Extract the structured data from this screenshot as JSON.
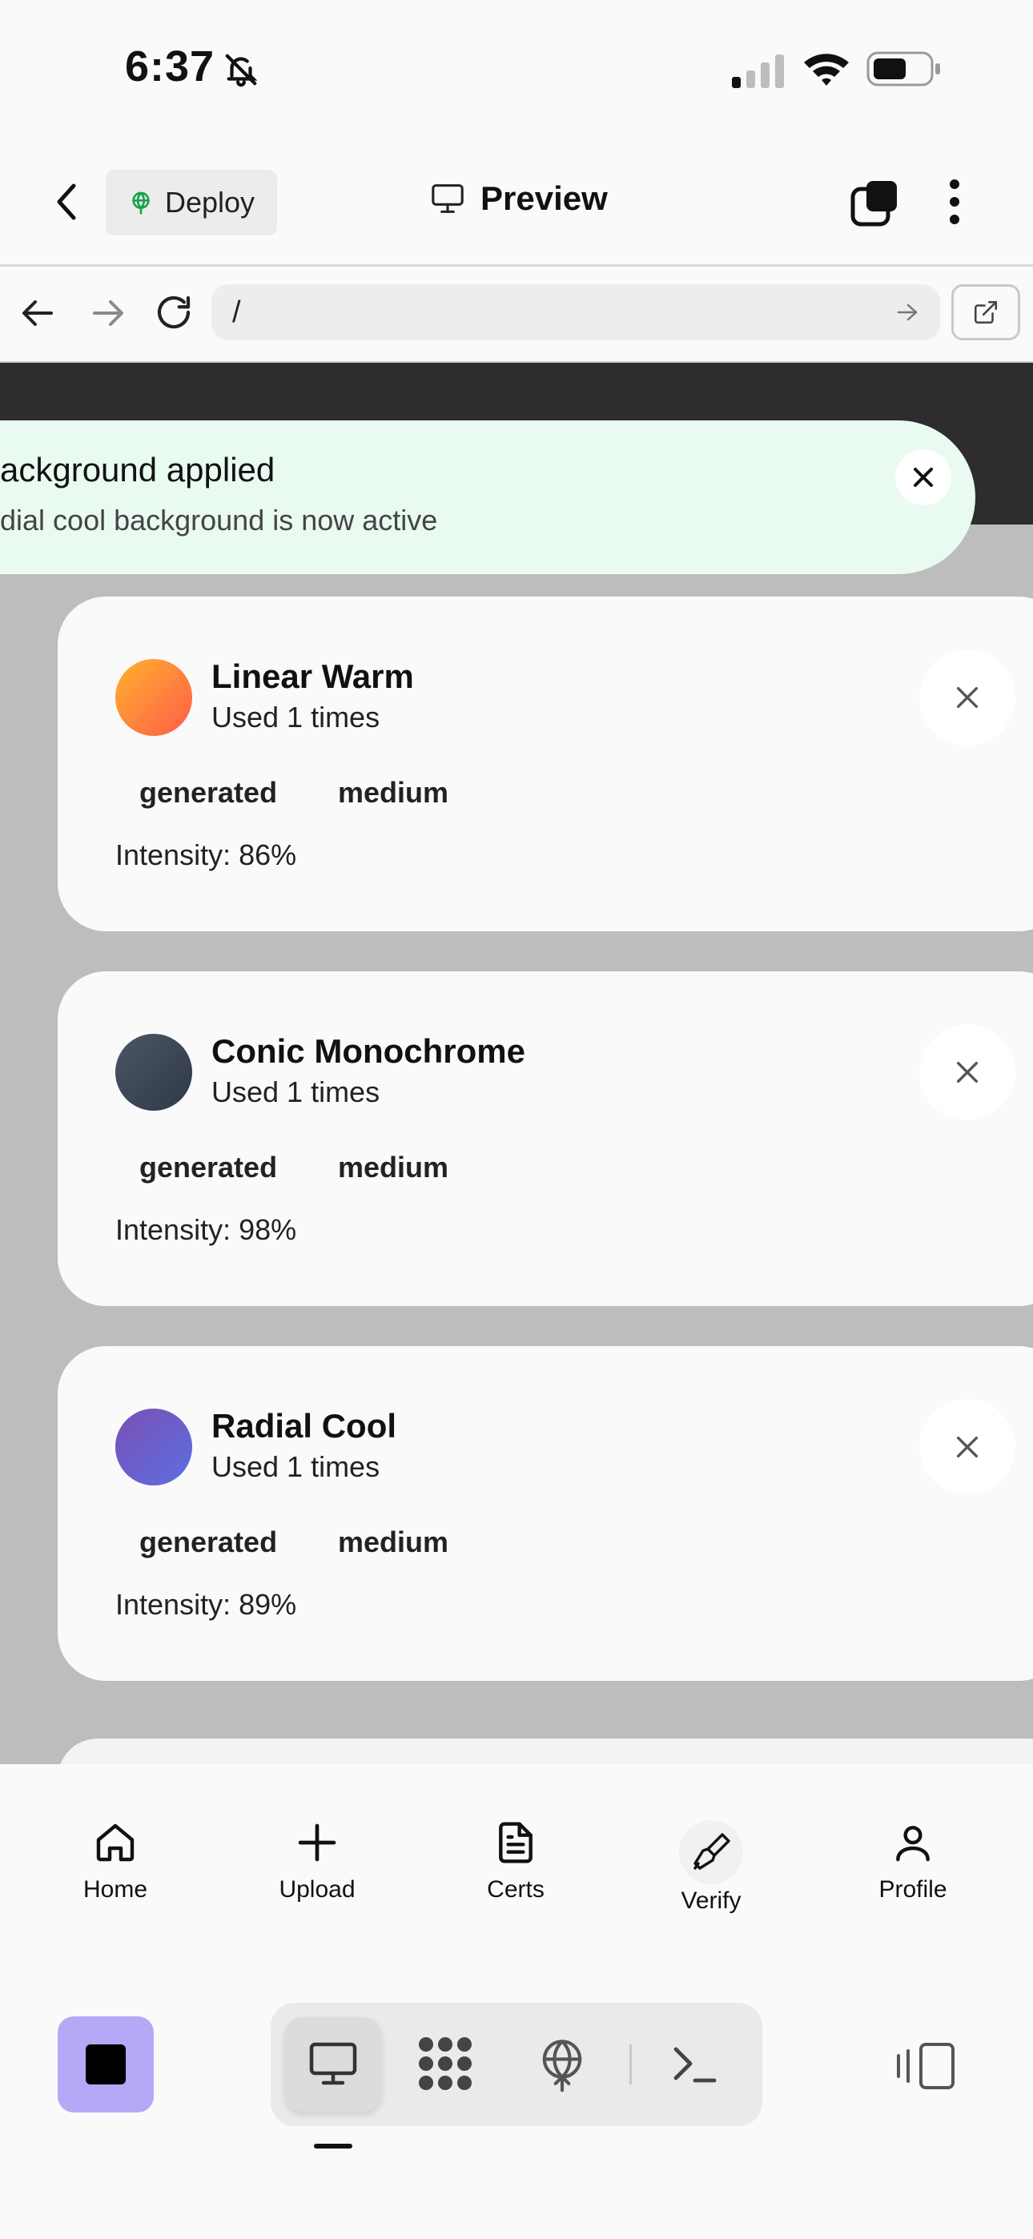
{
  "status_bar": {
    "time": "6:37"
  },
  "header": {
    "deploy_label": "Deploy",
    "title": "Preview"
  },
  "browser": {
    "url": "/"
  },
  "toast": {
    "title": "ackground applied",
    "description": "dial cool background is now active"
  },
  "cards": [
    {
      "name": "Linear Warm",
      "used": "Used 1 times",
      "badges": [
        "generated",
        "medium"
      ],
      "intensity": "Intensity: 86%",
      "swatch_from": "#ffb22e",
      "swatch_to": "#ff5c48"
    },
    {
      "name": "Conic Monochrome",
      "used": "Used 1 times",
      "badges": [
        "generated",
        "medium"
      ],
      "intensity": "Intensity: 98%",
      "swatch_from": "#4b5563",
      "swatch_to": "#2f3948"
    },
    {
      "name": "Radial Cool",
      "used": "Used 1 times",
      "badges": [
        "generated",
        "medium"
      ],
      "intensity": "Intensity: 89%",
      "swatch_from": "#5b6fe0",
      "swatch_to": "#7b4fb5"
    }
  ],
  "bottom_nav": [
    {
      "label": "Home",
      "icon": "home-icon"
    },
    {
      "label": "Upload",
      "icon": "plus-icon"
    },
    {
      "label": "Certs",
      "icon": "document-icon"
    },
    {
      "label": "Verify",
      "icon": "brush-icon"
    },
    {
      "label": "Profile",
      "icon": "user-icon"
    }
  ],
  "dock": {
    "stop_color": "#b6a8f7",
    "icons": [
      "monitor-icon",
      "grid-icon",
      "globe-icon",
      "terminal-icon",
      "panel-icon"
    ]
  }
}
